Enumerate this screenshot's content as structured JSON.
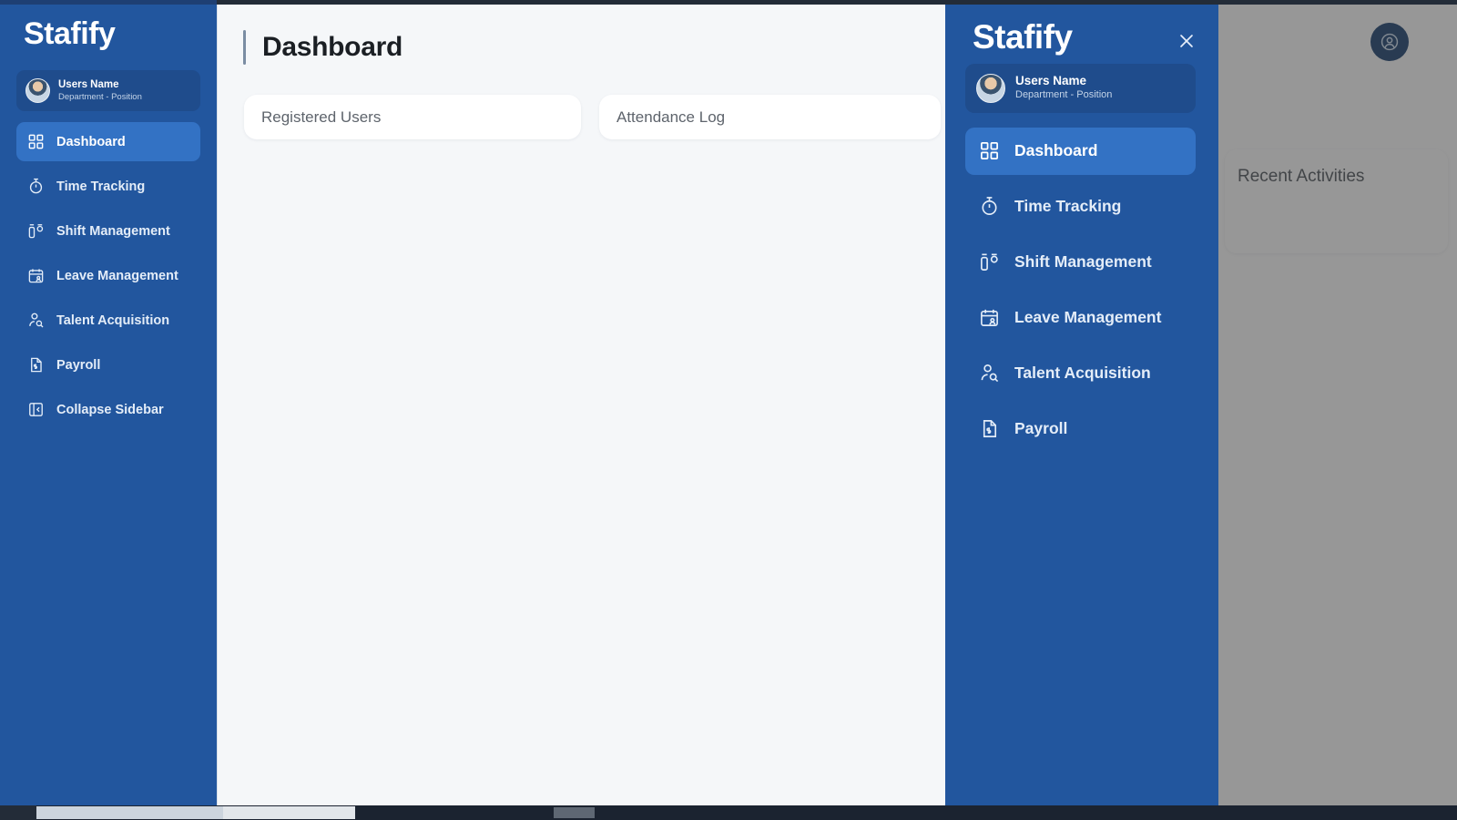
{
  "app": {
    "brand": "Stafify",
    "accent_blue": "#22569e",
    "active_item_blue": "#3372c4",
    "page_bg": "#f5f7f9"
  },
  "sidebar": {
    "brand": "Stafify",
    "user": {
      "name": "Users Name",
      "subtitle": "Department - Position"
    },
    "items": [
      {
        "label": "Dashboard",
        "icon": "grid-icon",
        "active": true
      },
      {
        "label": "Time Tracking",
        "icon": "stopwatch-icon",
        "active": false
      },
      {
        "label": "Shift Management",
        "icon": "shift-icon",
        "active": false
      },
      {
        "label": "Leave Management",
        "icon": "calendar-user-icon",
        "active": false
      },
      {
        "label": "Talent Acquisition",
        "icon": "user-search-icon",
        "active": false
      },
      {
        "label": "Payroll",
        "icon": "document-dollar-icon",
        "active": false
      },
      {
        "label": "Collapse Sidebar",
        "icon": "collapse-icon",
        "active": false
      }
    ]
  },
  "main": {
    "title": "Dashboard",
    "cards": [
      {
        "label": "Registered Users"
      },
      {
        "label": "Attendance Log"
      }
    ]
  },
  "right_panel": {
    "avatar_button_icon": "user-circle-icon",
    "activities_card": {
      "title": "Recent Activities"
    }
  },
  "drawer": {
    "brand": "Stafify",
    "close_icon": "close-icon",
    "user": {
      "name": "Users Name",
      "subtitle": "Department - Position"
    },
    "items": [
      {
        "label": "Dashboard",
        "icon": "grid-icon",
        "active": true
      },
      {
        "label": "Time Tracking",
        "icon": "stopwatch-icon",
        "active": false
      },
      {
        "label": "Shift Management",
        "icon": "shift-icon",
        "active": false
      },
      {
        "label": "Leave Management",
        "icon": "calendar-user-icon",
        "active": false
      },
      {
        "label": "Talent Acquisition",
        "icon": "user-search-icon",
        "active": false
      },
      {
        "label": "Payroll",
        "icon": "document-dollar-icon",
        "active": false
      }
    ]
  }
}
